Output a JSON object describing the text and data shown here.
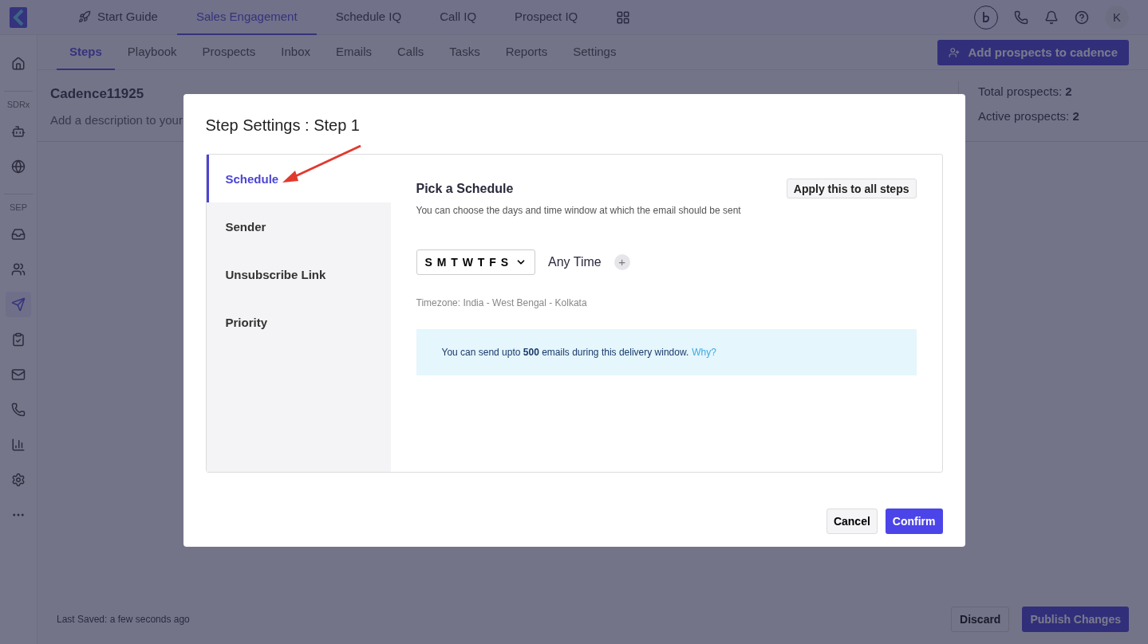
{
  "top_nav": {
    "items": [
      {
        "label": "Start Guide",
        "kind": "rocket",
        "selected": false
      },
      {
        "label": "Sales Engagement",
        "kind": "plain",
        "selected": true
      },
      {
        "label": "Schedule IQ",
        "kind": "plain",
        "selected": false
      },
      {
        "label": "Call IQ",
        "kind": "plain",
        "selected": false
      },
      {
        "label": "Prospect IQ",
        "kind": "plain",
        "selected": false
      }
    ],
    "avatar": "K"
  },
  "sidebar": {
    "sections": [
      {
        "items": [
          {
            "kind": "home",
            "selected": false
          }
        ]
      },
      {
        "label": "SDRx",
        "items": [
          {
            "kind": "bot",
            "selected": false
          },
          {
            "kind": "globe",
            "selected": false
          }
        ]
      },
      {
        "label": "SEP",
        "items": [
          {
            "kind": "inbox",
            "selected": false
          },
          {
            "kind": "users",
            "selected": false
          },
          {
            "kind": "send",
            "selected": true
          },
          {
            "kind": "clipboard",
            "selected": false
          },
          {
            "kind": "mail",
            "selected": false
          },
          {
            "kind": "phone",
            "selected": false
          },
          {
            "kind": "chart",
            "selected": false
          },
          {
            "kind": "settings",
            "selected": false
          },
          {
            "kind": "more",
            "selected": false
          }
        ]
      }
    ]
  },
  "tabs": [
    {
      "label": "Steps",
      "selected": true
    },
    {
      "label": "Playbook",
      "selected": false
    },
    {
      "label": "Prospects",
      "selected": false
    },
    {
      "label": "Inbox",
      "selected": false
    },
    {
      "label": "Emails",
      "selected": false
    },
    {
      "label": "Calls",
      "selected": false
    },
    {
      "label": "Tasks",
      "selected": false
    },
    {
      "label": "Reports",
      "selected": false
    },
    {
      "label": "Settings",
      "selected": false
    }
  ],
  "add_button": "Add prospects to cadence",
  "cadence": {
    "name": "Cadence11925",
    "description": "Add a description to your",
    "total": "Total prospects: **2**",
    "active": "Active prospects: **2**"
  },
  "footer": {
    "saved": "Last Saved: a few seconds ago",
    "discard": "Discard",
    "publish": "Publish Changes"
  },
  "modal": {
    "title": "Step Settings : Step 1",
    "menu": [
      {
        "label": "Schedule",
        "selected": true
      },
      {
        "label": "Sender",
        "selected": false
      },
      {
        "label": "Unsubscribe Link",
        "selected": false
      },
      {
        "label": "Priority",
        "selected": false
      }
    ],
    "heading": "Pick a Schedule",
    "apply": "Apply this to all steps",
    "subtitle": "You can choose the days and time window at which the email should be sent",
    "days": "S M T W T F S",
    "time": "Any Time",
    "plus": "+",
    "timezone": "Timezone: India - West Bengal - Kolkata",
    "info": "You can send upto **500** emails during this delivery window.",
    "info_link": "Why?",
    "cancel": "Cancel",
    "confirm": "Confirm"
  }
}
